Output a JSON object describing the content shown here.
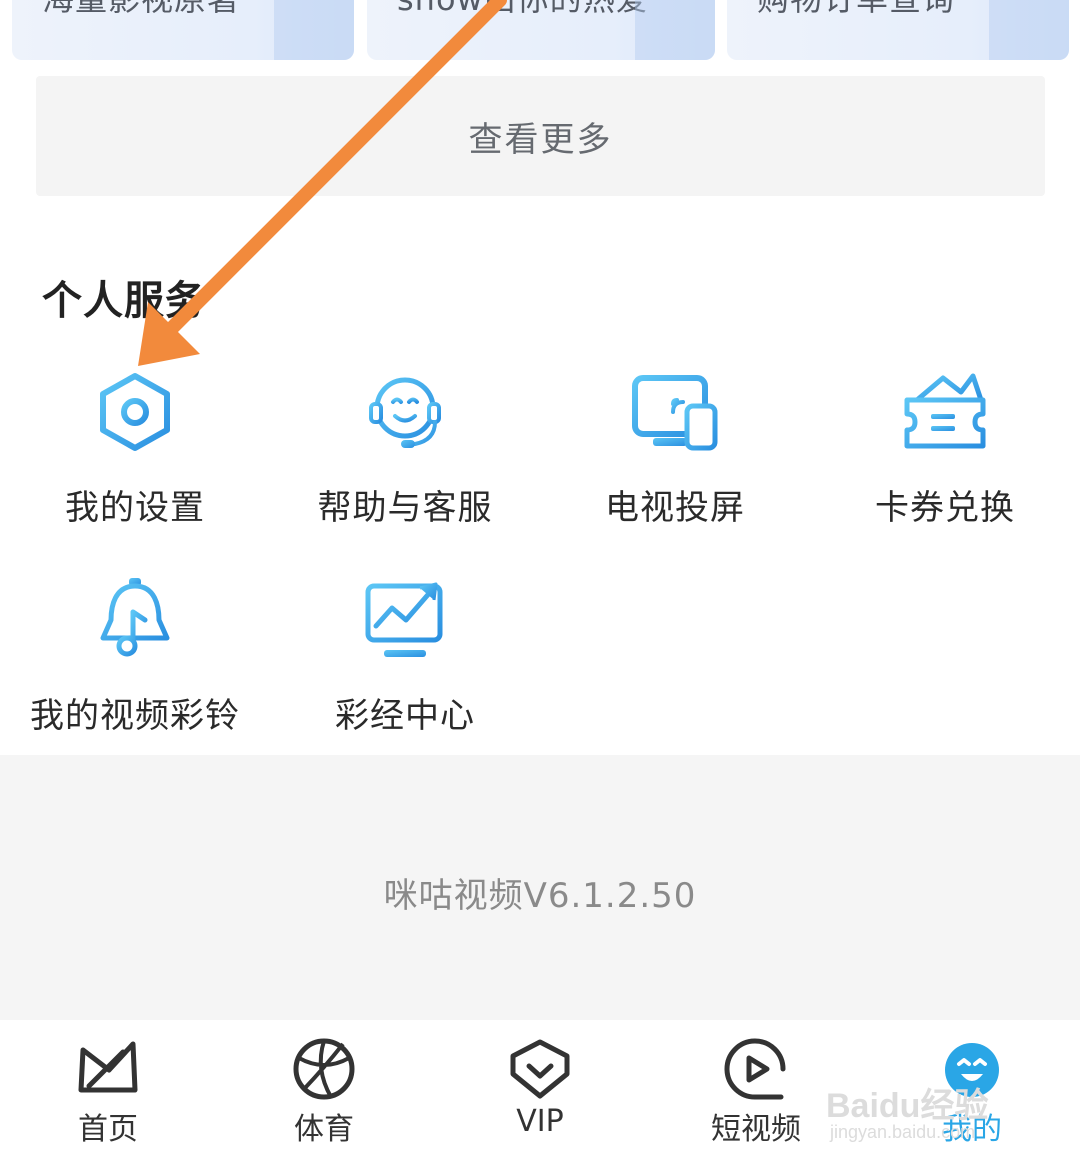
{
  "promo_cards": [
    {
      "label": "海量影视原著"
    },
    {
      "label": "show出你的热爱"
    },
    {
      "label": "购物订单查询"
    }
  ],
  "more_button": {
    "label": "查看更多"
  },
  "personal_services": {
    "title": "个人服务",
    "items": [
      {
        "label": "我的设置",
        "icon": "settings-hexagon-icon"
      },
      {
        "label": "帮助与客服",
        "icon": "customer-service-icon"
      },
      {
        "label": "电视投屏",
        "icon": "tv-cast-icon"
      },
      {
        "label": "卡券兑换",
        "icon": "coupon-wallet-icon"
      },
      {
        "label": "我的视频彩铃",
        "icon": "video-ringtone-bell-icon"
      },
      {
        "label": "彩经中心",
        "icon": "trend-chart-icon"
      }
    ]
  },
  "version_text": "咪咕视频V6.1.2.50",
  "tabbar": {
    "items": [
      {
        "label": "首页",
        "icon": "home-logo-icon",
        "active": false
      },
      {
        "label": "体育",
        "icon": "basketball-icon",
        "active": false
      },
      {
        "label": "VIP",
        "icon": "vip-diamond-icon",
        "active": false
      },
      {
        "label": "短视频",
        "icon": "play-circle-icon",
        "active": false
      },
      {
        "label": "我的",
        "icon": "smiley-face-icon",
        "active": true
      }
    ]
  },
  "watermark": {
    "text": "Baidu经验",
    "sub": "jingyan.baidu.com"
  },
  "colors": {
    "accent": "#2aa6e6",
    "annotation_arrow": "#f28a3c"
  }
}
